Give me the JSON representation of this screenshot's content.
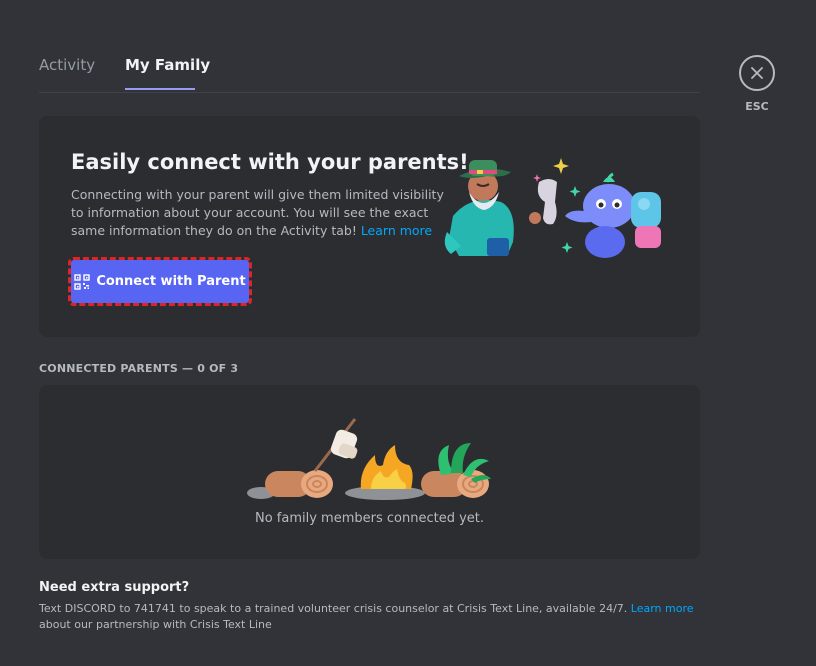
{
  "tabs": [
    {
      "label": "Activity"
    },
    {
      "label": "My Family"
    }
  ],
  "close": {
    "label": "ESC",
    "icon": "close-icon"
  },
  "hero": {
    "title": "Easily connect with your parents!",
    "description": "Connecting with your parent will give them limited visibility to information about your account. You will see the exact same information they do on the Activity tab!",
    "learn_more": "Learn more",
    "button_label": "Connect with Parent",
    "button_icon": "qr-code-icon"
  },
  "connected": {
    "label": "CONNECTED PARENTS — 0 OF 3",
    "empty_text": "No family members connected yet."
  },
  "support": {
    "title": "Need extra support?",
    "text_before": "Text DISCORD to 741741 to speak to a trained volunteer crisis counselor at Crisis Text Line, available 24/7.",
    "learn_more": "Learn more",
    "text_after": "about our partnership with Crisis Text Line"
  },
  "colors": {
    "background": "#313338",
    "card": "#2b2d31",
    "blurple": "#5865f2",
    "link": "#00a8fc",
    "tab_active_underline": "#949cf7"
  }
}
